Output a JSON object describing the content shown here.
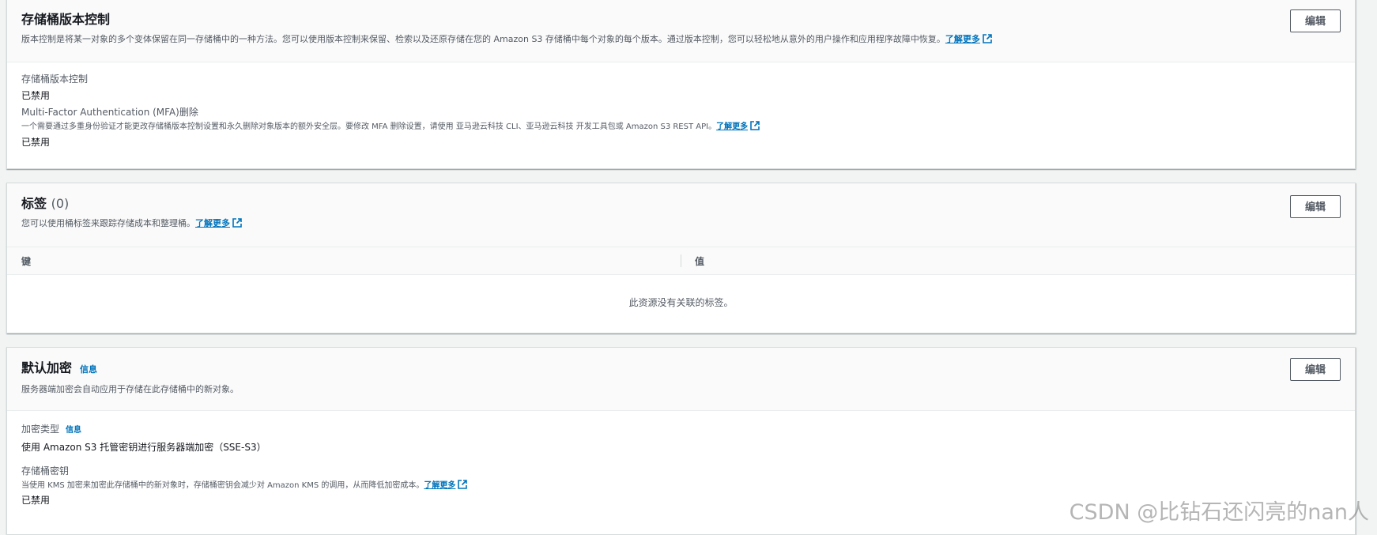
{
  "versioning": {
    "title": "存储桶版本控制",
    "description": "版本控制是将某一对象的多个变体保留在同一存储桶中的一种方法。您可以使用版本控制来保留、检索以及还原存储在您的 Amazon S3 存储桶中每个对象的每个版本。通过版本控制，您可以轻松地从意外的用户操作和应用程序故障中恢复。",
    "learn_more": "了解更多",
    "edit_label": "编辑",
    "versioning_label": "存储桶版本控制",
    "versioning_value": "已禁用",
    "mfa_label": "Multi-Factor Authentication (MFA)删除",
    "mfa_desc": "一个需要通过多重身份验证才能更改存储桶版本控制设置和永久删除对象版本的额外安全层。要修改 MFA 删除设置，请使用 亚马逊云科技 CLI、亚马逊云科技 开发工具包或 Amazon S3 REST API。",
    "mfa_learn_more": "了解更多",
    "mfa_value": "已禁用"
  },
  "tags": {
    "title": "标签",
    "count": "(0)",
    "description": "您可以使用桶标签来跟踪存储成本和整理桶。",
    "learn_more": "了解更多",
    "edit_label": "编辑",
    "columns": [
      "键",
      "值"
    ],
    "empty_message": "此资源没有关联的标签。"
  },
  "encryption": {
    "title": "默认加密",
    "info": "信息",
    "description": "服务器端加密会自动应用于存储在此存储桶中的新对象。",
    "edit_label": "编辑",
    "type_label": "加密类型",
    "type_info": "信息",
    "type_value": "使用 Amazon S3 托管密钥进行服务器端加密（SSE-S3）",
    "bucket_key_label": "存储桶密钥",
    "bucket_key_desc": "当使用 KMS 加密来加密此存储桶中的新对象时，存储桶密钥会减少对 Amazon KMS 的调用，从而降低加密成本。",
    "bucket_key_learn_more": "了解更多",
    "bucket_key_value": "已禁用"
  },
  "watermark": "CSDN @比钻石还闪亮的nan人",
  "colors": {
    "link": "#0073bb",
    "text": "#16191f",
    "secondary": "#545b64",
    "background": "#f2f3f3"
  },
  "icons": {
    "external_link": "external-link-icon"
  }
}
